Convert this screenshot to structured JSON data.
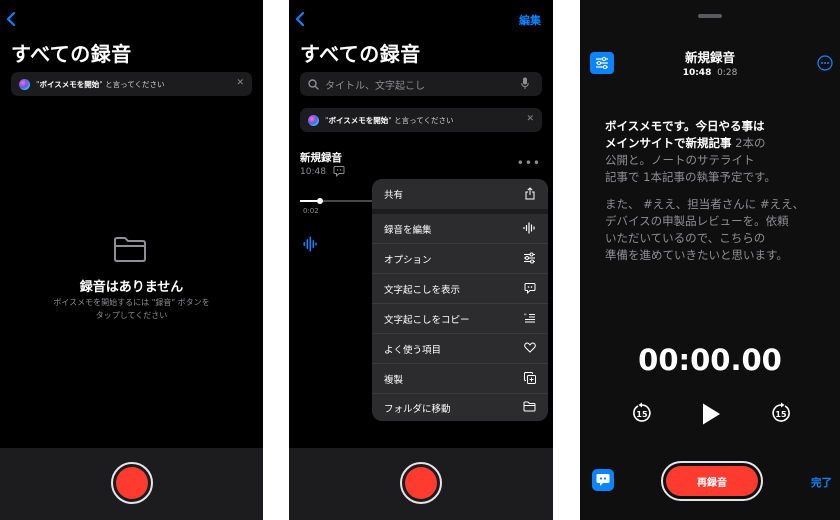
{
  "panel1": {
    "title": "すべての録音",
    "siri": {
      "prefix": "\"",
      "command": "ボイスメモを開始",
      "suffix": "\" と言ってください"
    },
    "empty_title": "録音はありません",
    "empty_line1": "ボイスメモを開始するには \"録音\" ボタンを",
    "empty_line2": "タップしてください"
  },
  "panel2": {
    "edit_label": "編集",
    "title": "すべての録音",
    "search_placeholder": "タイトル、文字起こし",
    "siri": {
      "prefix": "\"",
      "command": "ボイスメモを開始",
      "suffix": "\" と言ってください"
    },
    "recording": {
      "name": "新規録音",
      "time": "10:48",
      "position": "0:02",
      "progress": 0.25
    },
    "menu": [
      {
        "label": "共有",
        "icon": "share-icon"
      },
      {
        "label": "録音を編集",
        "icon": "waveform-icon"
      },
      {
        "label": "オプション",
        "icon": "sliders-icon"
      },
      {
        "label": "文字起こしを表示",
        "icon": "quote-bubble-icon"
      },
      {
        "label": "文字起こしをコピー",
        "icon": "copy-text-icon"
      },
      {
        "label": "よく使う項目",
        "icon": "heart-icon"
      },
      {
        "label": "複製",
        "icon": "duplicate-icon"
      },
      {
        "label": "フォルダに移動",
        "icon": "folder-icon"
      }
    ]
  },
  "panel3": {
    "title": "新規録音",
    "time": "10:48",
    "duration": "0:28",
    "para1_bold": [
      "ボイスメモです。今日やる事は",
      "メインサイトで新規記事"
    ],
    "para1_rest": [
      " 2本の",
      "公開と。ノートのサテライト",
      "記事で 1本記事の執筆予定です。"
    ],
    "para2": [
      "また、 #ええ、担当者さんに #ええ、",
      "デバイスの申製品レビューを。依頼",
      "いただいているので、こちらの",
      "準備を進めていきたいと思います。"
    ],
    "timer": "00:00.00",
    "skip_back": "15",
    "skip_forward": "15",
    "rerecord_label": "再録音",
    "done_label": "完了"
  },
  "colors": {
    "accent": "#0a84ff",
    "record": "#ff3b30",
    "background": "#000000",
    "sheet": "#1c1c1e"
  }
}
